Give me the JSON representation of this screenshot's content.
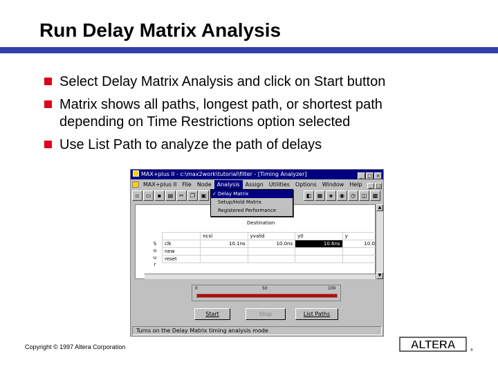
{
  "slide": {
    "title": "Run Delay Matrix Analysis",
    "bullets": [
      {
        "line1": "Select Delay Matrix Analysis and click on Start button",
        "line2": ""
      },
      {
        "line1": "Matrix shows all paths, longest path, or shortest path",
        "line2": "depending on Time Restrictions option selected"
      },
      {
        "line1": "Use List Path to analyze the path of delays",
        "line2": ""
      }
    ],
    "copyright": "Copyright © 1997 Altera Corporation",
    "logo_text": "ALTERA",
    "accent_color": "#3340a8",
    "bullet_color": "#e0001b"
  },
  "window": {
    "title": "MAX+plus II - c:\\max2work\\tutorial\\filter - [Timing Analyzer]",
    "menus": [
      "MAX+plus II",
      "File",
      "Node",
      "Analysis",
      "Assign",
      "Utilities",
      "Options",
      "Window",
      "Help"
    ],
    "active_menu": "Analysis",
    "dropdown": {
      "items": [
        "Delay Matrix",
        "Setup/Hold Matrix",
        "Registered Performance"
      ],
      "checked": "✓"
    },
    "matrix": {
      "destination_label": "Destination",
      "x_mark": "X",
      "columns": [
        "ncsl",
        "yvalid",
        "y0",
        "y"
      ],
      "source_label": [
        "S",
        "o",
        "u",
        "r"
      ],
      "rows": [
        {
          "source": "clk",
          "values": [
            "10.1ns",
            "10.0ns",
            "10.6ns",
            "10.0"
          ]
        },
        {
          "source": "new",
          "values": [
            "",
            "",
            "",
            ""
          ]
        },
        {
          "source": "reset",
          "values": [
            "",
            "",
            "",
            ""
          ]
        }
      ]
    },
    "progress": {
      "ticks": [
        "0",
        "50",
        "100"
      ],
      "value": 100
    },
    "buttons": {
      "start": "Start",
      "stop": "Stop",
      "list_paths": "List Paths"
    },
    "status": "Turns on the Delay Matrix timing analysis mode"
  }
}
